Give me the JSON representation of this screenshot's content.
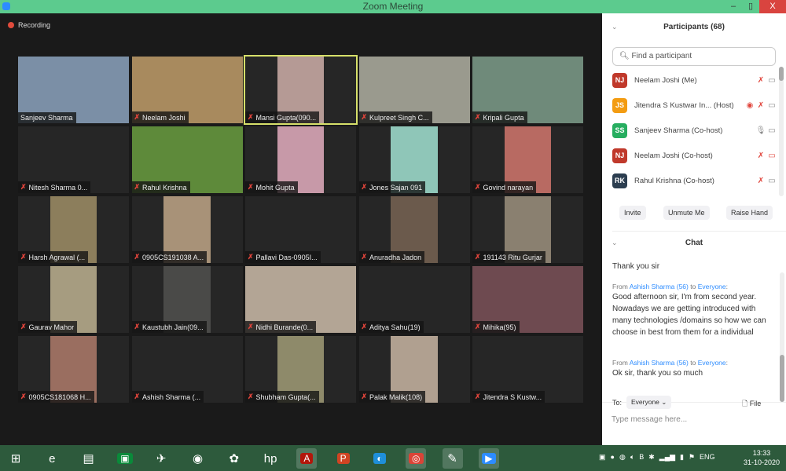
{
  "window": {
    "title": "Zoom Meeting",
    "minimize": "–",
    "maximize": "▯",
    "close": "X"
  },
  "recording": "Recording",
  "tiles": [
    {
      "name": "Sanjeev Sharma",
      "muted": false,
      "video": "full",
      "color": "#7b8fa6"
    },
    {
      "name": "Neelam Joshi",
      "muted": true,
      "video": "full",
      "color": "#a88a5e"
    },
    {
      "name": "Mansi Gupta(090...",
      "muted": true,
      "video": "portrait",
      "color": "#b59a95",
      "active": true
    },
    {
      "name": "Kulpreet Singh C...",
      "muted": true,
      "video": "full",
      "color": "#9a9a8e"
    },
    {
      "name": "Kripali Gupta",
      "muted": true,
      "video": "full",
      "color": "#6f8a7a"
    },
    {
      "name": "Nitesh Sharma 0...",
      "muted": true,
      "video": "none"
    },
    {
      "name": "Rahul Krishna",
      "muted": true,
      "video": "full",
      "color": "#5e8a3a"
    },
    {
      "name": "Mohit Gupta",
      "muted": true,
      "video": "portrait",
      "color": "#c799a8"
    },
    {
      "name": "Jones Sajan 091",
      "muted": true,
      "video": "portrait",
      "color": "#8fc6b8"
    },
    {
      "name": "Govind narayan",
      "muted": true,
      "video": "portrait",
      "color": "#b86a62"
    },
    {
      "name": "Harsh Agrawal (...",
      "muted": true,
      "video": "portrait",
      "color": "#8c7e5c"
    },
    {
      "name": "0905CS191038 A...",
      "muted": true,
      "video": "portrait",
      "color": "#a89278"
    },
    {
      "name": "Pallavi Das-0905I...",
      "muted": true,
      "video": "none"
    },
    {
      "name": "Anuradha Jadon",
      "muted": true,
      "video": "portrait",
      "color": "#6b5a4c"
    },
    {
      "name": "191143 Ritu Gurjar",
      "muted": true,
      "video": "portrait",
      "color": "#8a8070"
    },
    {
      "name": "Gaurav Mahor",
      "muted": true,
      "video": "portrait",
      "color": "#a69c80"
    },
    {
      "name": "Kaustubh Jain(09...",
      "muted": true,
      "video": "portrait",
      "color": "#4a4a48"
    },
    {
      "name": "Nidhi Burande(0...",
      "muted": true,
      "video": "full",
      "color": "#b3a595"
    },
    {
      "name": "Aditya Sahu(19)",
      "muted": true,
      "video": "none"
    },
    {
      "name": "Mihika(95)",
      "muted": true,
      "video": "full",
      "color": "#6e4a50"
    },
    {
      "name": "0905CS181068 H...",
      "muted": true,
      "video": "portrait",
      "color": "#9a6e60"
    },
    {
      "name": "Ashish Sharma (...",
      "muted": true,
      "video": "none"
    },
    {
      "name": "Shubham Gupta(...",
      "muted": true,
      "video": "portrait",
      "color": "#8e8a6a"
    },
    {
      "name": "Palak Malik(108)",
      "muted": true,
      "video": "portrait",
      "color": "#b0a090"
    },
    {
      "name": "Jitendra S Kustw...",
      "muted": true,
      "video": "none"
    }
  ],
  "participants": {
    "title": "Participants (68)",
    "search_placeholder": "Find a participant",
    "list": [
      {
        "initials": "NJ",
        "name": "Neelam Joshi (Me)",
        "color": "#c0392b",
        "mic": "muted",
        "cam": "on"
      },
      {
        "initials": "JS",
        "name": "Jitendra S Kustwar In... (Host)",
        "color": "#f39c12",
        "mic": "muted",
        "cam": "on",
        "recording": true
      },
      {
        "initials": "SS",
        "name": "Sanjeev Sharma (Co-host)",
        "color": "#27ae60",
        "mic": "on",
        "cam": "on"
      },
      {
        "initials": "NJ",
        "name": "Neelam Joshi (Co-host)",
        "color": "#c0392b",
        "mic": "muted",
        "cam": "off"
      },
      {
        "initials": "RK",
        "name": "Rahul Krishna (Co-host)",
        "color": "#2c3e50",
        "mic": "muted",
        "cam": "on"
      }
    ],
    "buttons": {
      "invite": "Invite",
      "unmute": "Unmute Me",
      "raise_hand": "Raise Hand"
    }
  },
  "chat": {
    "title": "Chat",
    "messages": [
      {
        "text": "Thank you sir"
      },
      {
        "from": "Ashish Sharma (56)",
        "to": "Everyone",
        "text": "Good afternoon sir, I'm from second year. Nowadays we are getting introduced with many technologies /domains so how we can choose in best from them for a individual"
      },
      {
        "from": "Ashish Sharma (56)",
        "to": "Everyone",
        "text": "Ok sir, thank you so much"
      }
    ],
    "from_label": "From",
    "to_word": "to",
    "to_label": "To:",
    "recipient": "Everyone",
    "file_label": "File",
    "input_placeholder": "Type message here..."
  },
  "taskbar": {
    "language": "ENG",
    "time": "13:33",
    "date": "31-10-2020",
    "apps": [
      "windows-start",
      "internet-explorer",
      "file-explorer",
      "store",
      "app-rocket",
      "webcam-app",
      "media-app",
      "hp",
      "acrobat-reader",
      "powerpoint",
      "edge",
      "chrome",
      "paint",
      "zoom"
    ]
  }
}
